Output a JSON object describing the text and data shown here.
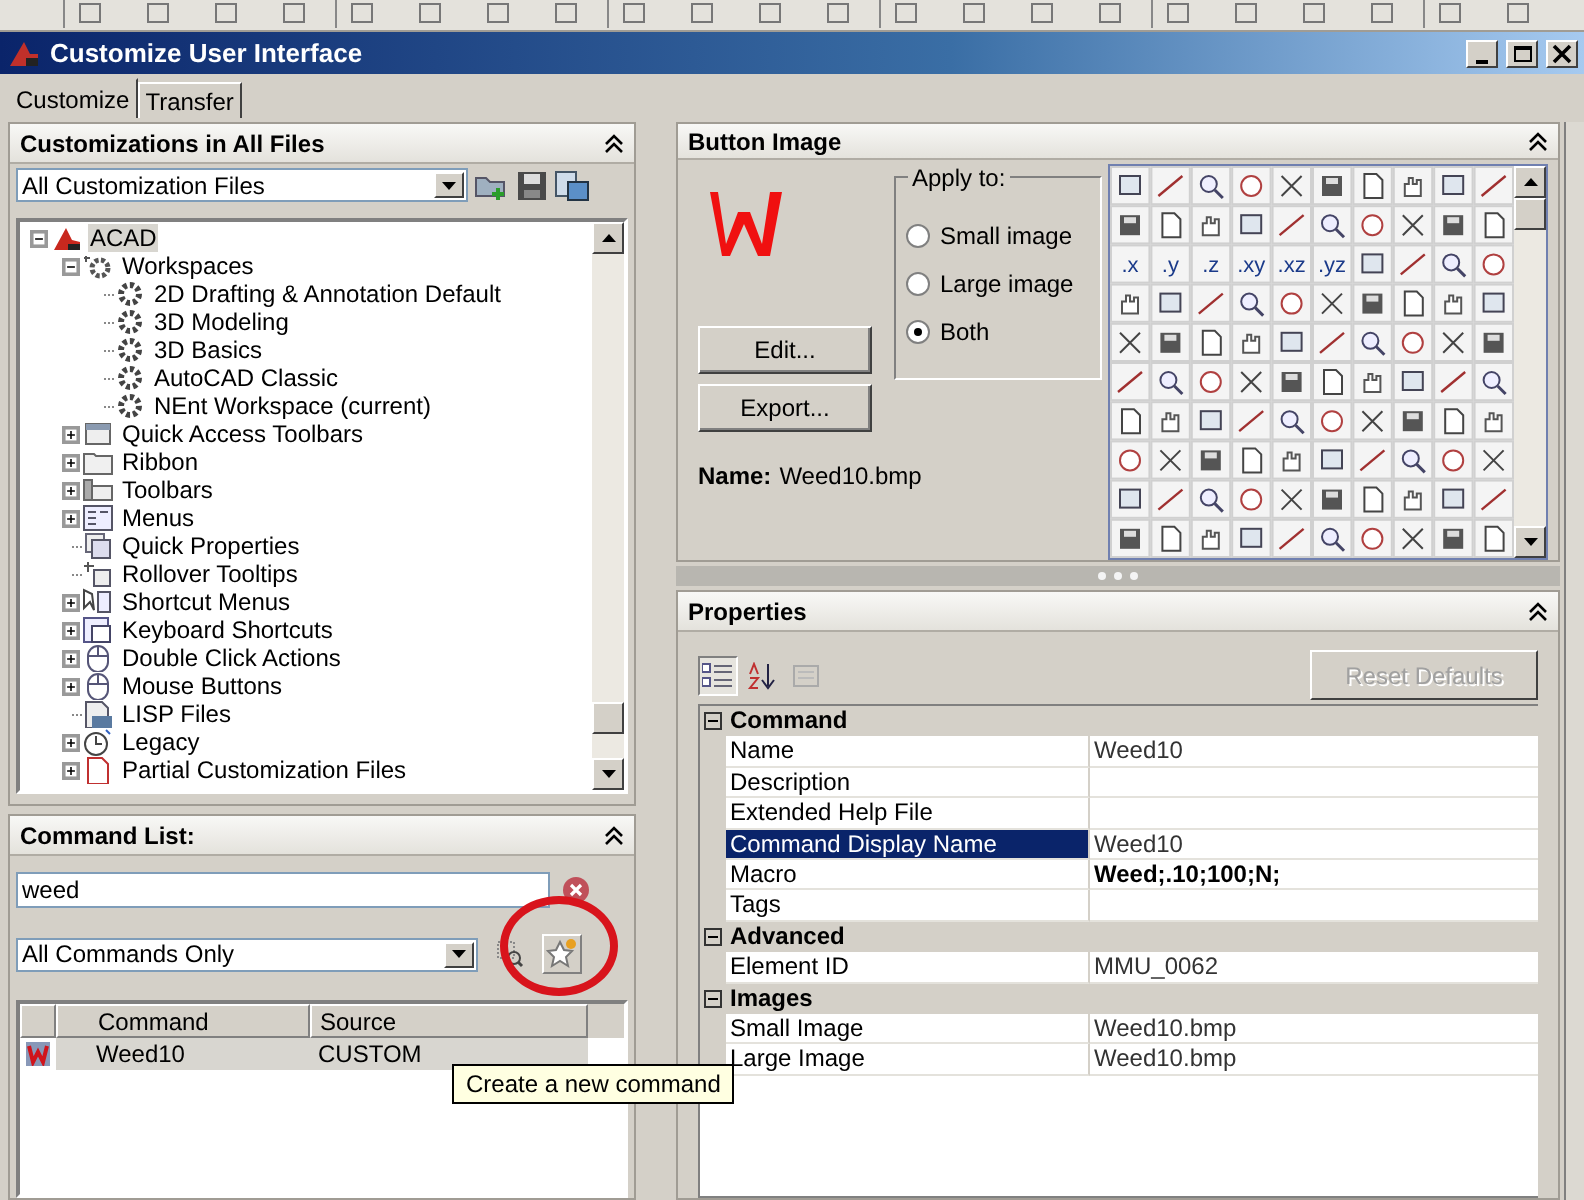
{
  "window": {
    "title": "Customize User Interface"
  },
  "tabs": [
    {
      "label": "Customize",
      "selected": true
    },
    {
      "label": "Transfer",
      "selected": false
    }
  ],
  "customizations": {
    "title": "Customizations in All Files",
    "file_filter": "All Customization Files",
    "tree": [
      {
        "label": "ACAD",
        "kind": "branch",
        "expanded": true,
        "selected": true,
        "children": [
          {
            "label": "Workspaces",
            "kind": "branch",
            "expanded": true,
            "selected": false,
            "children": [
              {
                "label": "2D Drafting & Annotation Default",
                "kind": "leaf",
                "selected": false
              },
              {
                "label": "3D Modeling",
                "kind": "leaf",
                "selected": false
              },
              {
                "label": "3D Basics",
                "kind": "leaf",
                "selected": false
              },
              {
                "label": "AutoCAD Classic",
                "kind": "leaf",
                "selected": false
              },
              {
                "label": "NEnt Workspace (current)",
                "kind": "leaf",
                "selected": false
              }
            ]
          },
          {
            "label": "Quick Access Toolbars",
            "kind": "branch",
            "expanded": false,
            "selected": false
          },
          {
            "label": "Ribbon",
            "kind": "branch",
            "expanded": false,
            "selected": false
          },
          {
            "label": "Toolbars",
            "kind": "branch",
            "expanded": false,
            "selected": false
          },
          {
            "label": "Menus",
            "kind": "branch",
            "expanded": false,
            "selected": false
          },
          {
            "label": "Quick Properties",
            "kind": "leaf",
            "selected": false
          },
          {
            "label": "Rollover Tooltips",
            "kind": "leaf",
            "selected": false
          },
          {
            "label": "Shortcut Menus",
            "kind": "branch",
            "expanded": false,
            "selected": false
          },
          {
            "label": "Keyboard Shortcuts",
            "kind": "branch",
            "expanded": false,
            "selected": false
          },
          {
            "label": "Double Click Actions",
            "kind": "branch",
            "expanded": false,
            "selected": false
          },
          {
            "label": "Mouse Buttons",
            "kind": "branch",
            "expanded": false,
            "selected": false
          },
          {
            "label": "LISP Files",
            "kind": "leaf",
            "selected": false
          },
          {
            "label": "Legacy",
            "kind": "branch",
            "expanded": false,
            "selected": false
          },
          {
            "label": "Partial Customization Files",
            "kind": "branch",
            "expanded": false,
            "selected": false
          }
        ]
      }
    ]
  },
  "command_list": {
    "title": "Command List:",
    "search": {
      "value": "weed"
    },
    "filter": "All Commands Only",
    "columns": [
      "Command",
      "Source"
    ],
    "rows": [
      {
        "command": "Weed10",
        "source": "CUSTOM",
        "selected": true
      }
    ]
  },
  "tooltip": "Create a new command",
  "button_image": {
    "title": "Button Image",
    "buttons": [
      "Edit...",
      "Export..."
    ],
    "name_label": "Name:",
    "name_value": "Weed10.bmp",
    "apply_to": {
      "label": "Apply to:",
      "options": [
        {
          "label": "Small image",
          "selected": false
        },
        {
          "label": "Large image",
          "selected": false
        },
        {
          "label": "Both",
          "selected": true
        }
      ]
    },
    "text_icons": [
      ".x",
      ".y",
      ".z",
      ".xy",
      ".xz",
      ".yz"
    ]
  },
  "properties": {
    "title": "Properties",
    "reset": {
      "label": "Reset Defaults",
      "disabled": true
    },
    "groups": [
      {
        "name": "Command",
        "expanded": true,
        "rows": [
          {
            "label": "Name",
            "value": "Weed10",
            "selected": false,
            "bold": false
          },
          {
            "label": "Description",
            "selected": false
          },
          {
            "label": "Extended Help File",
            "selected": false
          },
          {
            "label": "Command Display Name",
            "value": "Weed10",
            "selected": true,
            "bold": false
          },
          {
            "label": "Macro",
            "value": "Weed;.10;100;N;",
            "selected": false,
            "bold": true
          },
          {
            "label": "Tags",
            "selected": false
          }
        ]
      },
      {
        "name": "Advanced",
        "expanded": true,
        "rows": [
          {
            "label": "Element ID",
            "value": "MMU_0062",
            "selected": false,
            "bold": false
          }
        ]
      },
      {
        "name": "Images",
        "expanded": true,
        "rows": [
          {
            "label": "Small Image",
            "value": "Weed10.bmp",
            "selected": false,
            "bold": false
          },
          {
            "label": "Large Image",
            "value": "Weed10.bmp",
            "selected": false,
            "bold": false
          }
        ]
      }
    ]
  }
}
